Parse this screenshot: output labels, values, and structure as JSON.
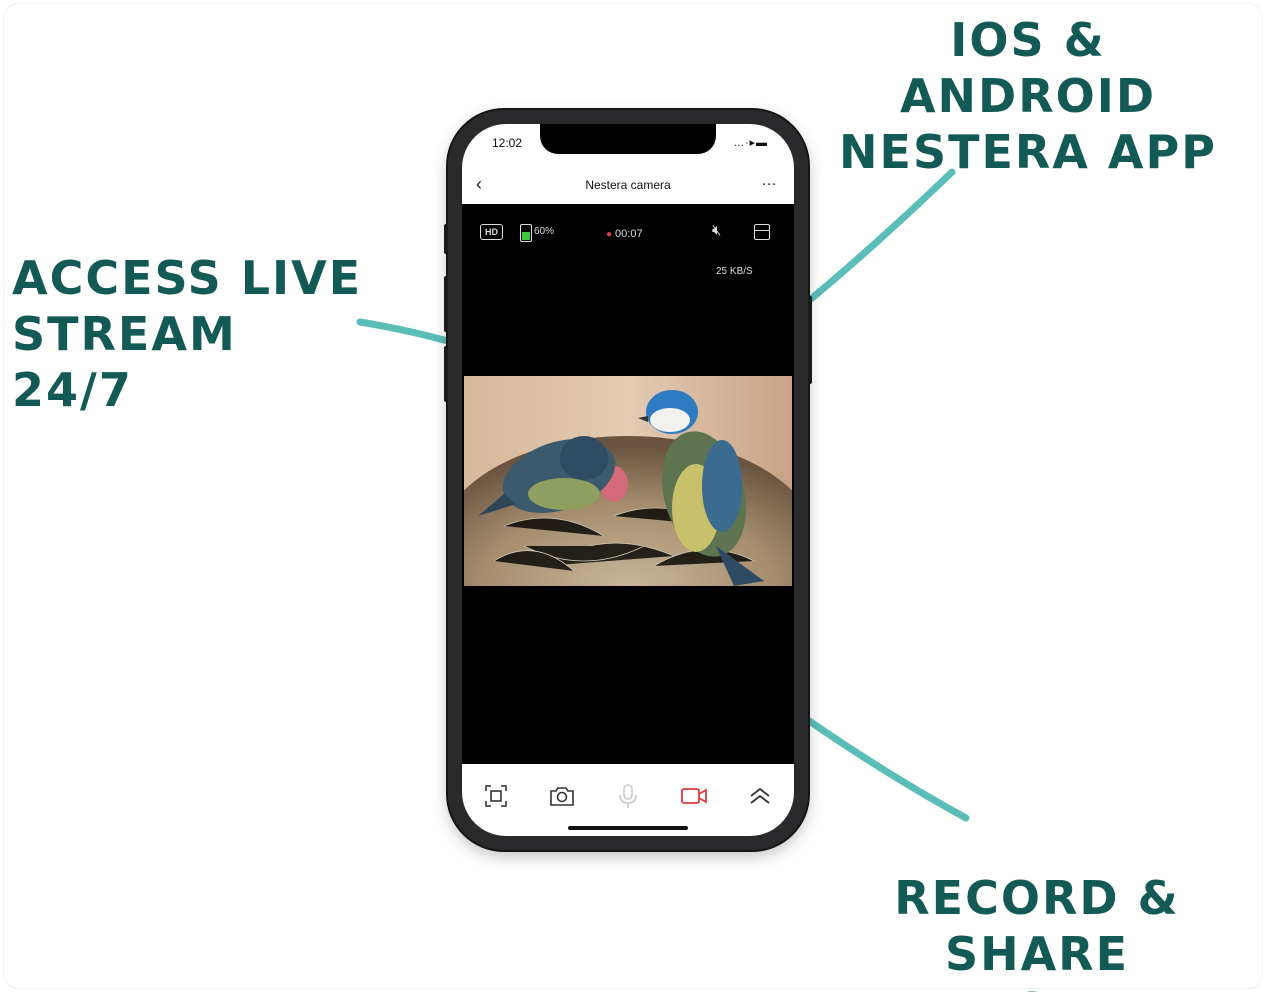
{
  "callouts": {
    "ios_android": "IOS & ANDROID\nNESTERA APP",
    "live_stream": "ACCESS LIVE\nSTREAM 24/7",
    "record_share": "RECORD & SHARE\nEASILY"
  },
  "phone": {
    "status_time": "12:02",
    "status_icons": "…∙▸▬",
    "header_title": "Nestera camera",
    "back_label": "‹",
    "more_label": "…"
  },
  "player": {
    "quality_badge": "HD",
    "battery_level": 0.6,
    "battery_text": "60%",
    "recording_time": "00:07",
    "speed": "25 KB/S"
  },
  "toolbar": {
    "items": [
      "screenshot-frame-icon",
      "camera-icon",
      "microphone-icon",
      "video-record-icon",
      "chevron-up-icon"
    ]
  },
  "colors": {
    "callout": "#135a56",
    "arrow": "#5bbdb8",
    "record_accent": "#e23b3b",
    "battery": "#3ec43e"
  }
}
